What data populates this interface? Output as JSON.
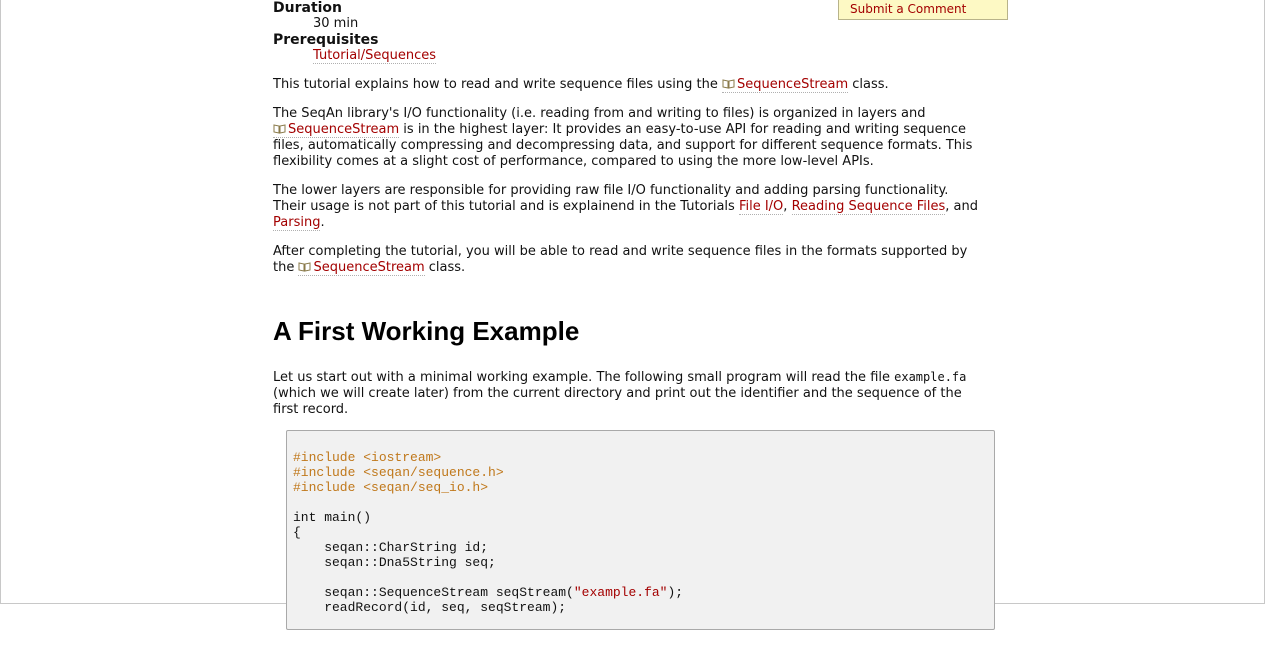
{
  "meta": {
    "duration_label": "Duration",
    "duration_value": "30 min",
    "prereq_label": "Prerequisites",
    "prereq_link": "Tutorial/Sequences"
  },
  "comment_button": "Submit a Comment",
  "intro": {
    "p1_a": "This tutorial explains how to read and write sequence files using the ",
    "p1_link": "SequenceStream",
    "p1_b": " class.",
    "p2_link": "SequenceStream",
    "p2_a": "The SeqAn library's I/O functionality (i.e. reading from and writing to files) is organized in layers and",
    "p2_b": " is in the highest layer: It provides an easy-to-use API for reading and writing sequence",
    "p2_c": "files, automatically compressing and decompressing data, and support for different sequence formats. This",
    "p2_d": "flexibility comes at a slight cost of performance, compared to using the more low-level APIs.",
    "p3_a": "The lower layers are responsible for providing raw file I/O functionality and adding parsing functionality.",
    "p3_b": "Their usage is not part of this tutorial and is explainend in the Tutorials ",
    "p3_link1": "File I/O",
    "p3_sep1": ", ",
    "p3_link2": "Reading Sequence Files",
    "p3_sep2": ", and",
    "p3_link3": "Parsing",
    "p3_end": ".",
    "p4_a": "After completing the tutorial, you will be able to read and write sequence files in the formats supported by",
    "p4_b": "the ",
    "p4_link": "SequenceStream",
    "p4_c": " class."
  },
  "section": {
    "heading": "A First Working Example",
    "p1_a": "Let us start out with a minimal working example. The following small program will read the file ",
    "p1_code": "example.fa",
    "p1_b": "(which we will create later) from the current directory and print out the identifier and the sequence of the",
    "p1_c": "first record."
  },
  "code": {
    "l1": "#include <iostream>",
    "l2": "#include <seqan/sequence.h>",
    "l3": "#include <seqan/seq_io.h>",
    "l5a": "int",
    "l5b": " main()",
    "l6": "{",
    "l7": "    seqan::CharString id;",
    "l8": "    seqan::Dna5String seq;",
    "l10a": "    seqan::SequenceStream seqStream(",
    "l10b": "\"example.fa\"",
    "l10c": ");",
    "l11": "    readRecord(id, seq, seqStream);"
  }
}
